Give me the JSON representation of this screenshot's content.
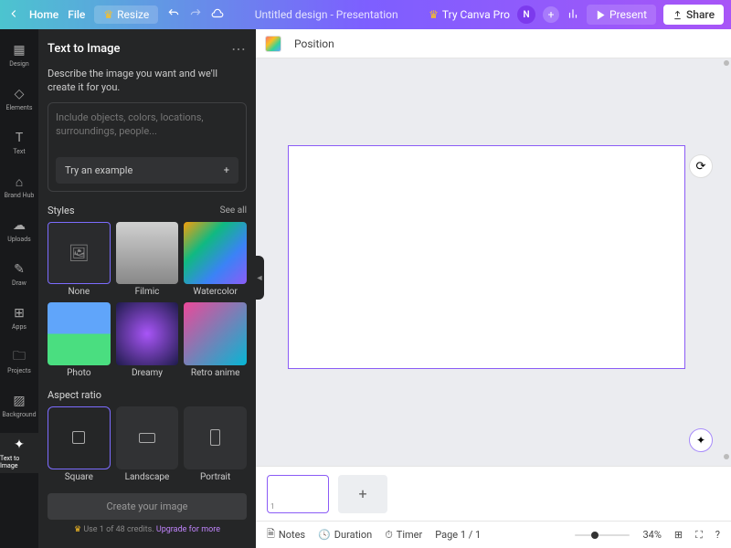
{
  "topbar": {
    "home": "Home",
    "file": "File",
    "resize": "Resize",
    "title": "Untitled design - Presentation",
    "tryPro": "Try Canva Pro",
    "avatar": "N",
    "present": "Present",
    "share": "Share"
  },
  "iconbar": [
    {
      "label": "Design"
    },
    {
      "label": "Elements"
    },
    {
      "label": "Text"
    },
    {
      "label": "Brand Hub"
    },
    {
      "label": "Uploads"
    },
    {
      "label": "Draw"
    },
    {
      "label": "Apps"
    },
    {
      "label": "Projects"
    },
    {
      "label": "Background"
    },
    {
      "label": "Text to Image"
    }
  ],
  "panel": {
    "title": "Text to Image",
    "desc": "Describe the image you want and we'll create it for you.",
    "placeholder": "Include objects, colors, locations, surroundings, people...",
    "example": "Try an example",
    "styles": {
      "heading": "Styles",
      "see": "See all",
      "items": [
        "None",
        "Filmic",
        "Watercolor",
        "Photo",
        "Dreamy",
        "Retro anime"
      ]
    },
    "aspect": {
      "heading": "Aspect ratio",
      "items": [
        "Square",
        "Landscape",
        "Portrait"
      ]
    },
    "cta": "Create your image",
    "credits": "Use 1 of 48 credits.",
    "upgrade": "Upgrade for more"
  },
  "context": {
    "position": "Position"
  },
  "pages": {
    "thumbNum": "1"
  },
  "status": {
    "notes": "Notes",
    "duration": "Duration",
    "timer": "Timer",
    "page": "Page 1 / 1",
    "zoom": "34%"
  }
}
